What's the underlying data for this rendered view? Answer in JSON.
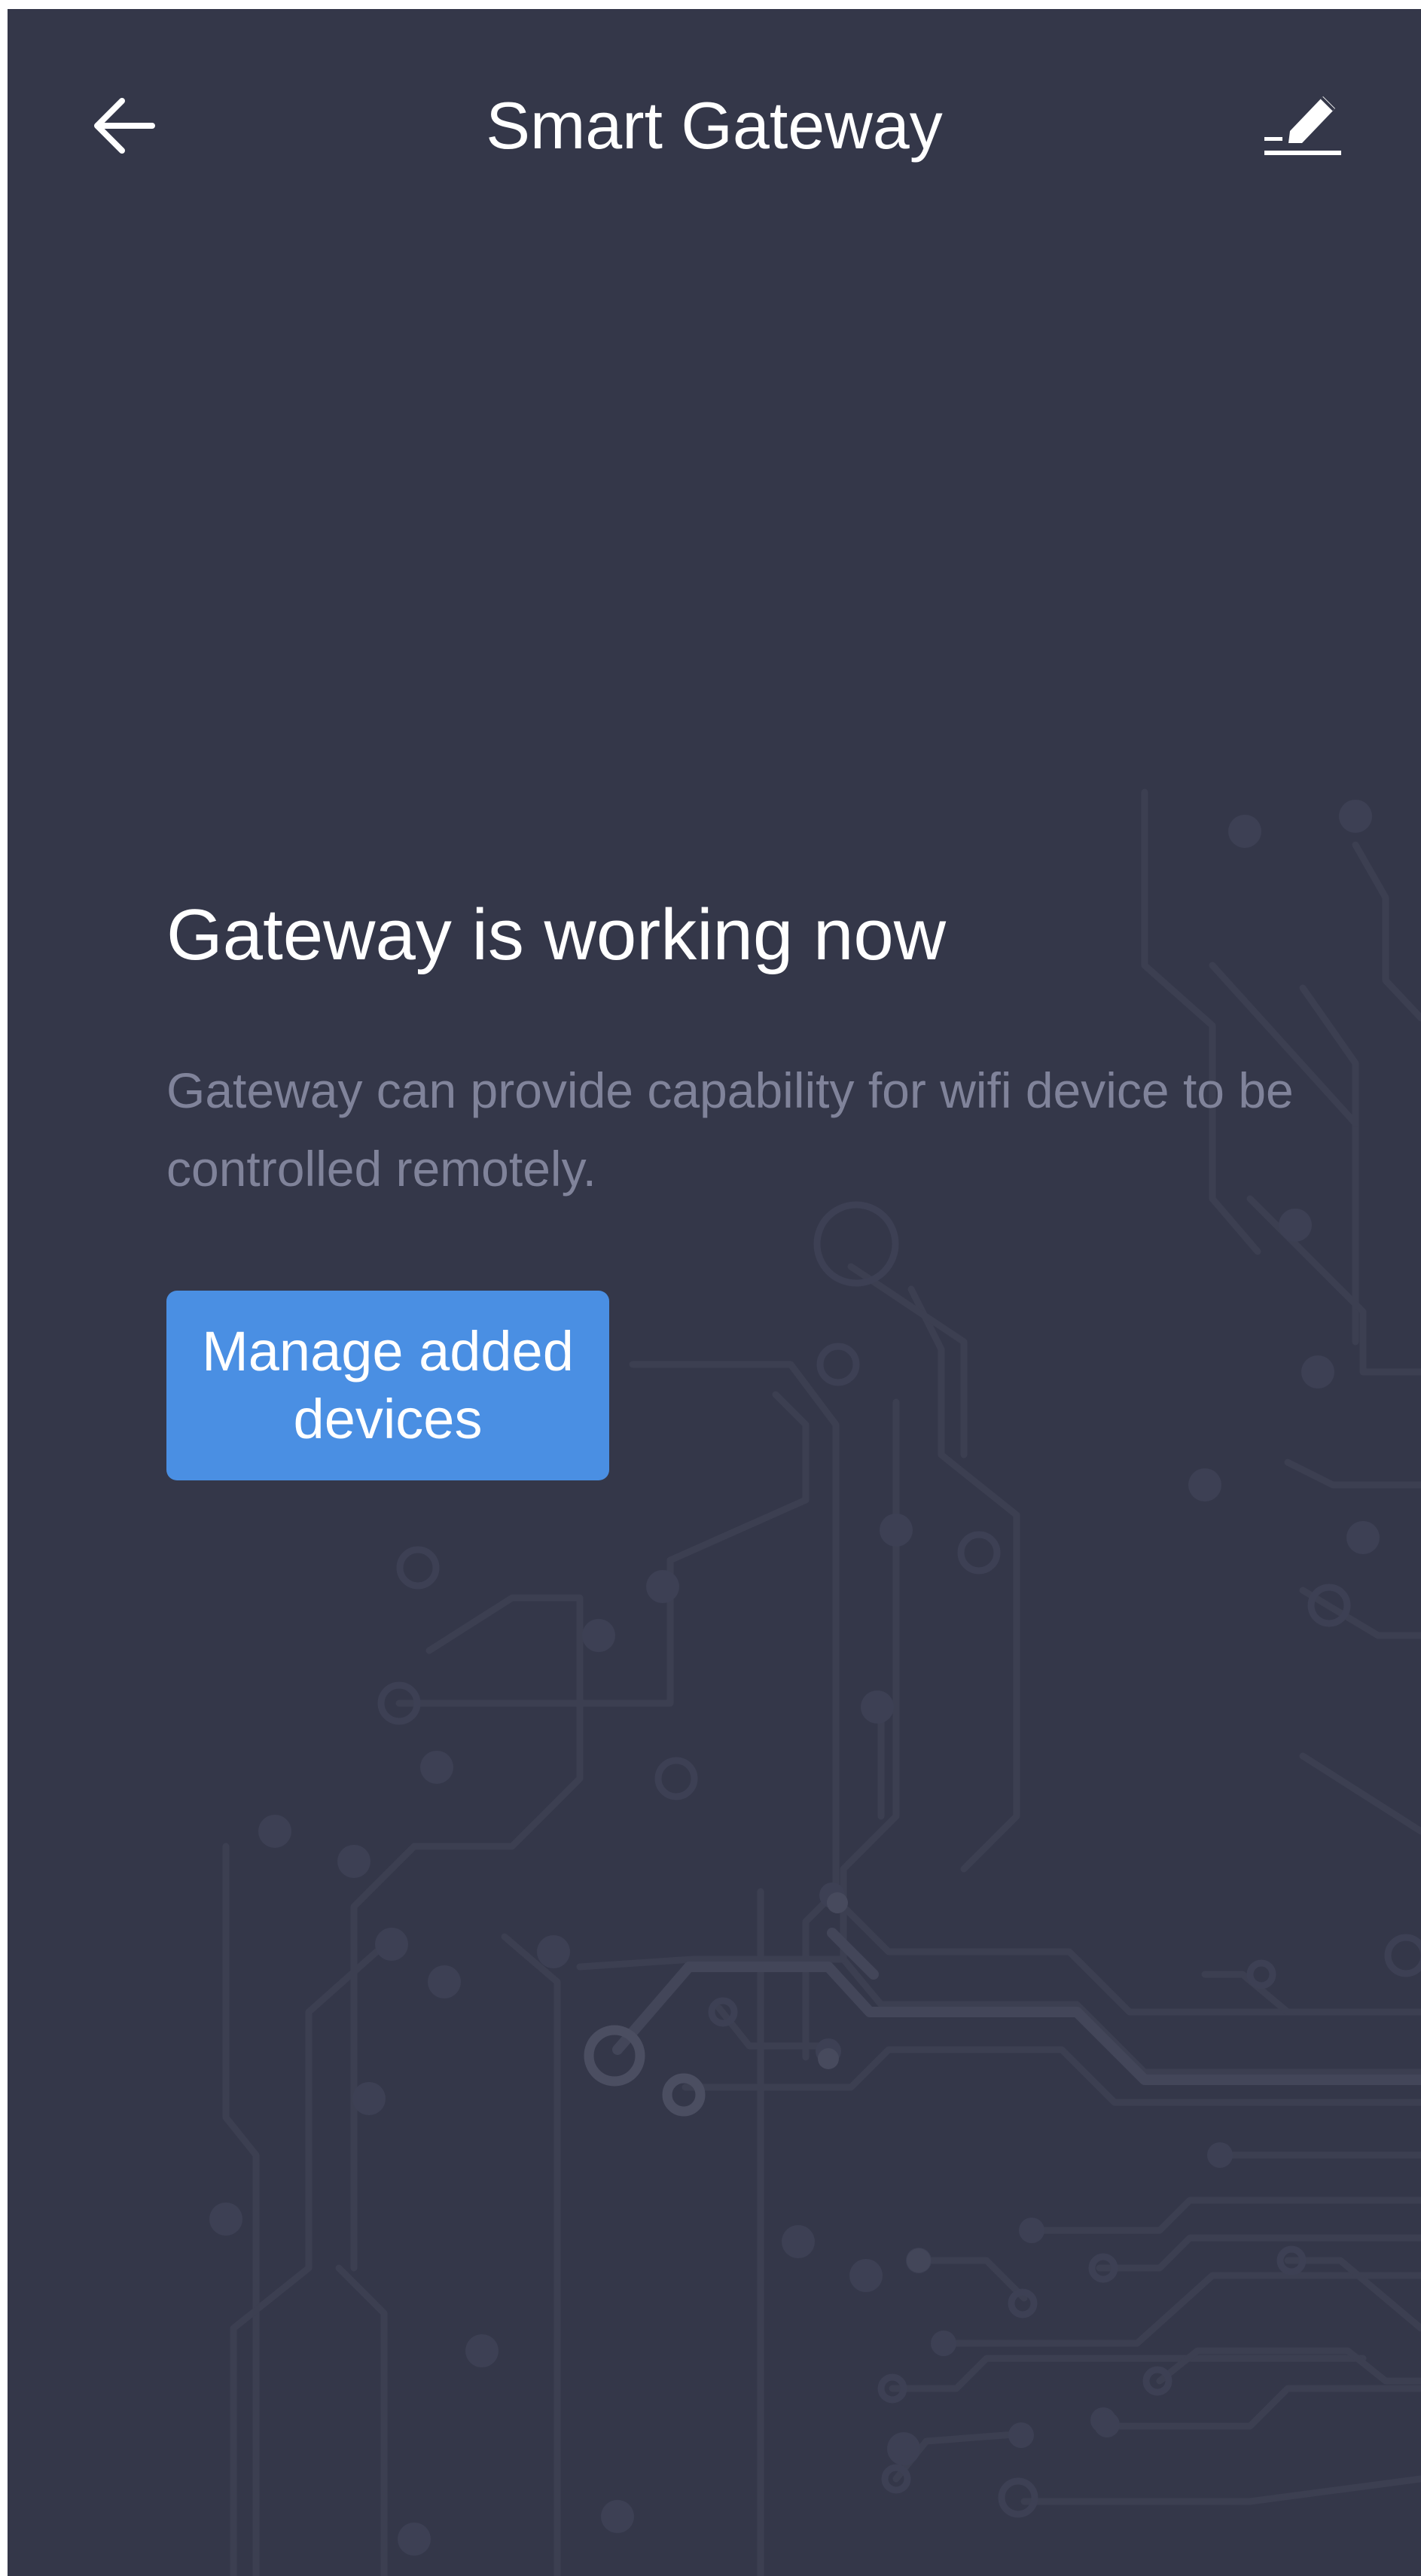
{
  "header": {
    "back_icon": "arrow-left-icon",
    "title": "Smart Gateway",
    "edit_icon": "pencil-edit-icon"
  },
  "status": {
    "heading": "Gateway is working now",
    "description_line1": "Gateway can provide capability for wifi device to be",
    "description_line2": "controlled remotely."
  },
  "actions": {
    "manage_label": "Manage added devices"
  },
  "colors": {
    "background": "#343749",
    "accent": "#4a8fe3",
    "secondary_text": "#80839a",
    "circuit_lines": "#3d4052"
  }
}
